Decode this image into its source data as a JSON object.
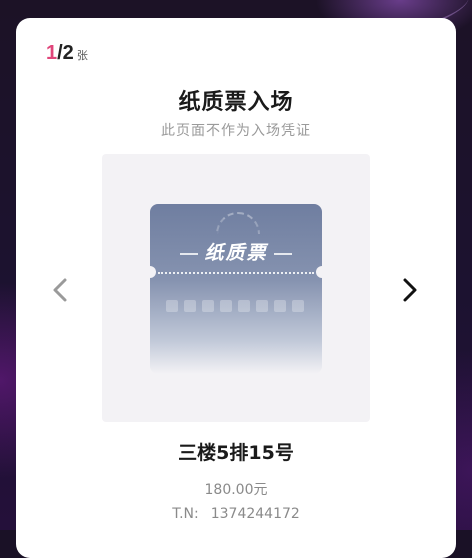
{
  "counter": {
    "current": "1",
    "total": "/2",
    "unit": "张"
  },
  "ticket": {
    "title": "纸质票入场",
    "subtitle": "此页面不作为入场凭证",
    "image_label": "纸质票",
    "seat": "三楼5排15号",
    "price": "180.00元",
    "tn_label": "T.N:",
    "tn_value": "1374244172"
  },
  "icons": {
    "prev": "chevron-left-icon",
    "next": "chevron-right-icon"
  },
  "colors": {
    "accent": "#e0457a",
    "ticket_blue": "#6f7ea0",
    "background": "#1a1126"
  }
}
